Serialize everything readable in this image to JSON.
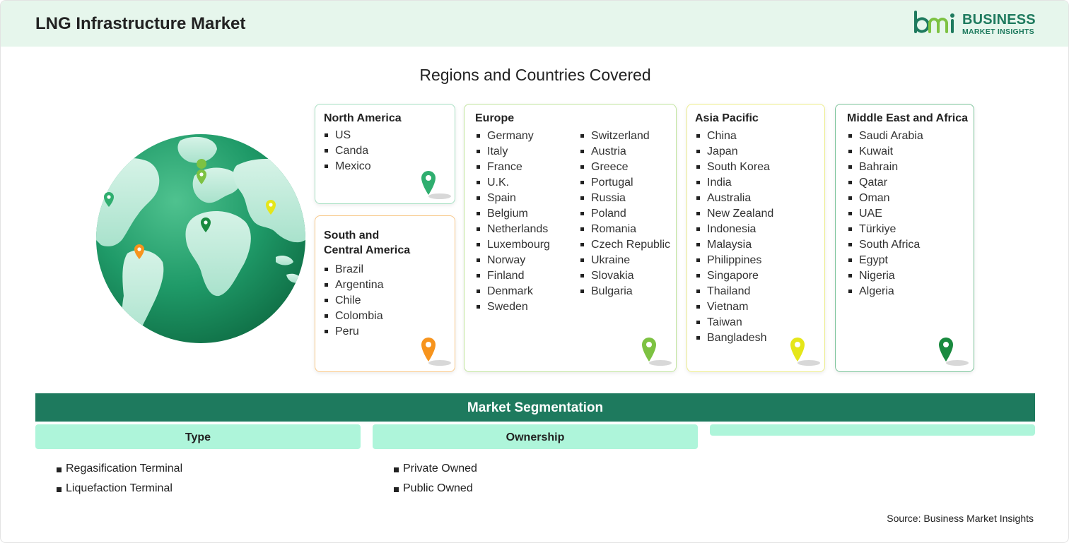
{
  "header": {
    "title": "LNG Infrastructure Market",
    "logo_line1": "BUSINESS",
    "logo_line2": "MARKET INSIGHTS"
  },
  "subtitle": "Regions and Countries Covered",
  "regions": {
    "north_america": {
      "title": "North America",
      "color": "#2fae6f",
      "items": [
        "US",
        "Canda",
        "Mexico"
      ]
    },
    "south_america": {
      "title_line1": "South and",
      "title_line2": "Central America",
      "color": "#f7941d",
      "items": [
        "Brazil",
        "Argentina",
        "Chile",
        "Colombia",
        "Peru"
      ]
    },
    "europe": {
      "title": "Europe",
      "color": "#7dc242",
      "col1": [
        "Germany",
        "Italy",
        "France",
        "U.K.",
        "Spain",
        "Belgium",
        "Netherlands",
        "Luxembourg",
        "Norway",
        "Finland",
        "Denmark",
        "Sweden"
      ],
      "col2": [
        "Switzerland",
        "Austria",
        "Greece",
        "Portugal",
        "Russia",
        "Poland",
        "Romania",
        "Czech Republic",
        "Ukraine",
        "Slovakia",
        "Bulgaria"
      ]
    },
    "asia_pacific": {
      "title": "Asia Pacific",
      "color": "#e5e619",
      "items": [
        "China",
        "Japan",
        "South Korea",
        "India",
        "Australia",
        "New Zealand",
        "Indonesia",
        "Malaysia",
        "Philippines",
        "Singapore",
        "Thailand",
        "Vietnam",
        "Taiwan",
        "Bangladesh"
      ]
    },
    "mea": {
      "title": "Middle East and Africa",
      "color": "#1a8a3f",
      "items": [
        "Saudi Arabia",
        "Kuwait",
        "Bahrain",
        "Qatar",
        "Oman",
        "UAE",
        "Türkiye",
        "South Africa",
        "Egypt",
        "Nigeria",
        "Algeria"
      ]
    }
  },
  "segmentation": {
    "title": "Market Segmentation",
    "type": {
      "label": "Type",
      "items": [
        "Regasification Terminal",
        "Liquefaction Terminal"
      ]
    },
    "ownership": {
      "label": "Ownership",
      "items": [
        "Private Owned",
        "Public Owned"
      ]
    }
  },
  "source": "Source: Business Market Insights",
  "colors": {
    "accent": "#1e7a5e",
    "header_bg": "#e6f6ec",
    "segment_tab": "#aef5da"
  }
}
